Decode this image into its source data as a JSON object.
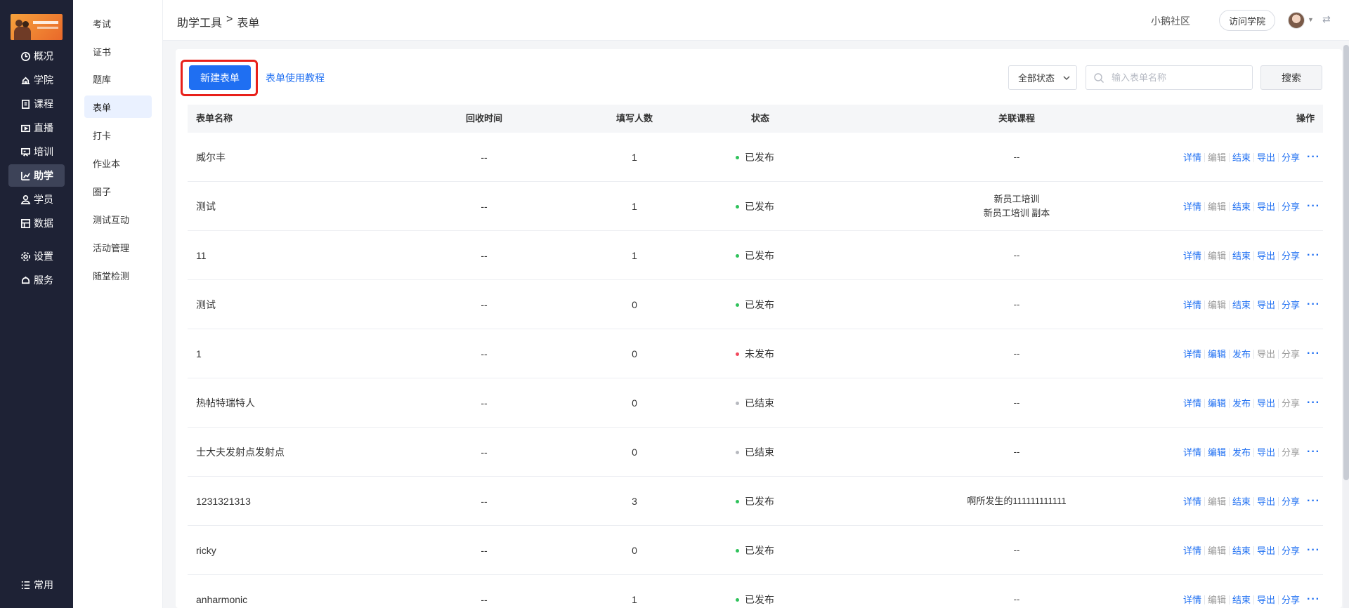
{
  "logo": {
    "lettering": ""
  },
  "nav": [
    {
      "label": "概况",
      "icon": "clock-icon",
      "active": false
    },
    {
      "label": "学院",
      "icon": "academy-icon",
      "active": false
    },
    {
      "label": "课程",
      "icon": "book-icon",
      "active": false
    },
    {
      "label": "直播",
      "icon": "live-icon",
      "active": false
    },
    {
      "label": "培训",
      "icon": "training-icon",
      "active": false
    },
    {
      "label": "助学",
      "icon": "chart-icon",
      "active": true
    },
    {
      "label": "学员",
      "icon": "user-icon",
      "active": false
    },
    {
      "label": "数据",
      "icon": "data-icon",
      "active": false
    },
    {
      "label": "设置",
      "icon": "gear-icon",
      "active": false
    },
    {
      "label": "服务",
      "icon": "service-icon",
      "active": false
    }
  ],
  "nav_footer": {
    "label": "常用",
    "icon": "list-icon"
  },
  "subnav": [
    {
      "label": "考试",
      "active": false
    },
    {
      "label": "证书",
      "active": false
    },
    {
      "label": "题库",
      "active": false
    },
    {
      "label": "表单",
      "active": true
    },
    {
      "label": "打卡",
      "active": false
    },
    {
      "label": "作业本",
      "active": false
    },
    {
      "label": "圈子",
      "active": false
    },
    {
      "label": "测试互动",
      "active": false
    },
    {
      "label": "活动管理",
      "active": false
    },
    {
      "label": "随堂检测",
      "active": false
    }
  ],
  "header": {
    "breadcrumb": [
      "助学工具",
      ">",
      "表单"
    ],
    "community_link": "小鹅社区",
    "visit_button": "访问学院"
  },
  "toolbar": {
    "new_button": "新建表单",
    "tutorial_link": "表单使用教程",
    "status_select": "全部状态",
    "search_placeholder": "输入表单名称",
    "search_button": "搜索"
  },
  "table": {
    "columns": {
      "name": "表单名称",
      "time": "回收时间",
      "count": "填写人数",
      "status": "状态",
      "course": "关联课程",
      "ops": "操作"
    },
    "rows": [
      {
        "name": "威尔丰",
        "time": "--",
        "count": "1",
        "status": "已发布",
        "status_color": "#2fc25b",
        "course": [
          "--"
        ],
        "ops": [
          {
            "label": "详情",
            "on": true
          },
          {
            "label": "编辑",
            "on": false
          },
          {
            "label": "结束",
            "on": true
          },
          {
            "label": "导出",
            "on": true
          },
          {
            "label": "分享",
            "on": true
          }
        ]
      },
      {
        "name": "测试",
        "time": "--",
        "count": "1",
        "status": "已发布",
        "status_color": "#2fc25b",
        "course": [
          "新员工培训",
          "新员工培训 副本"
        ],
        "ops": [
          {
            "label": "详情",
            "on": true
          },
          {
            "label": "编辑",
            "on": false
          },
          {
            "label": "结束",
            "on": true
          },
          {
            "label": "导出",
            "on": true
          },
          {
            "label": "分享",
            "on": true
          }
        ]
      },
      {
        "name": "11",
        "time": "--",
        "count": "1",
        "status": "已发布",
        "status_color": "#2fc25b",
        "course": [
          "--"
        ],
        "ops": [
          {
            "label": "详情",
            "on": true
          },
          {
            "label": "编辑",
            "on": false
          },
          {
            "label": "结束",
            "on": true
          },
          {
            "label": "导出",
            "on": true
          },
          {
            "label": "分享",
            "on": true
          }
        ]
      },
      {
        "name": "测试",
        "time": "--",
        "count": "0",
        "status": "已发布",
        "status_color": "#2fc25b",
        "course": [
          "--"
        ],
        "ops": [
          {
            "label": "详情",
            "on": true
          },
          {
            "label": "编辑",
            "on": false
          },
          {
            "label": "结束",
            "on": true
          },
          {
            "label": "导出",
            "on": true
          },
          {
            "label": "分享",
            "on": true
          }
        ]
      },
      {
        "name": "1",
        "time": "--",
        "count": "0",
        "status": "未发布",
        "status_color": "#f2495c",
        "course": [
          "--"
        ],
        "ops": [
          {
            "label": "详情",
            "on": true
          },
          {
            "label": "编辑",
            "on": true
          },
          {
            "label": "发布",
            "on": true
          },
          {
            "label": "导出",
            "on": false
          },
          {
            "label": "分享",
            "on": false
          }
        ]
      },
      {
        "name": "热帖特瑞特人",
        "time": "--",
        "count": "0",
        "status": "已结束",
        "status_color": "#b7b9bf",
        "course": [
          "--"
        ],
        "ops": [
          {
            "label": "详情",
            "on": true
          },
          {
            "label": "编辑",
            "on": true
          },
          {
            "label": "发布",
            "on": true
          },
          {
            "label": "导出",
            "on": true
          },
          {
            "label": "分享",
            "on": false
          }
        ]
      },
      {
        "name": "士大夫发射点发射点",
        "time": "--",
        "count": "0",
        "status": "已结束",
        "status_color": "#b7b9bf",
        "course": [
          "--"
        ],
        "ops": [
          {
            "label": "详情",
            "on": true
          },
          {
            "label": "编辑",
            "on": true
          },
          {
            "label": "发布",
            "on": true
          },
          {
            "label": "导出",
            "on": true
          },
          {
            "label": "分享",
            "on": false
          }
        ]
      },
      {
        "name": "1231321313",
        "time": "--",
        "count": "3",
        "status": "已发布",
        "status_color": "#2fc25b",
        "course": [
          "啊所发生的111111111111"
        ],
        "ops": [
          {
            "label": "详情",
            "on": true
          },
          {
            "label": "编辑",
            "on": false
          },
          {
            "label": "结束",
            "on": true
          },
          {
            "label": "导出",
            "on": true
          },
          {
            "label": "分享",
            "on": true
          }
        ]
      },
      {
        "name": "ricky",
        "time": "--",
        "count": "0",
        "status": "已发布",
        "status_color": "#2fc25b",
        "course": [
          "--"
        ],
        "ops": [
          {
            "label": "详情",
            "on": true
          },
          {
            "label": "编辑",
            "on": false
          },
          {
            "label": "结束",
            "on": true
          },
          {
            "label": "导出",
            "on": true
          },
          {
            "label": "分享",
            "on": true
          }
        ]
      },
      {
        "name": "anharmonic",
        "time": "--",
        "count": "1",
        "status": "已发布",
        "status_color": "#2fc25b",
        "course": [
          "--"
        ],
        "ops": [
          {
            "label": "详情",
            "on": true
          },
          {
            "label": "编辑",
            "on": false
          },
          {
            "label": "结束",
            "on": true
          },
          {
            "label": "导出",
            "on": true
          },
          {
            "label": "分享",
            "on": true
          }
        ]
      }
    ]
  }
}
